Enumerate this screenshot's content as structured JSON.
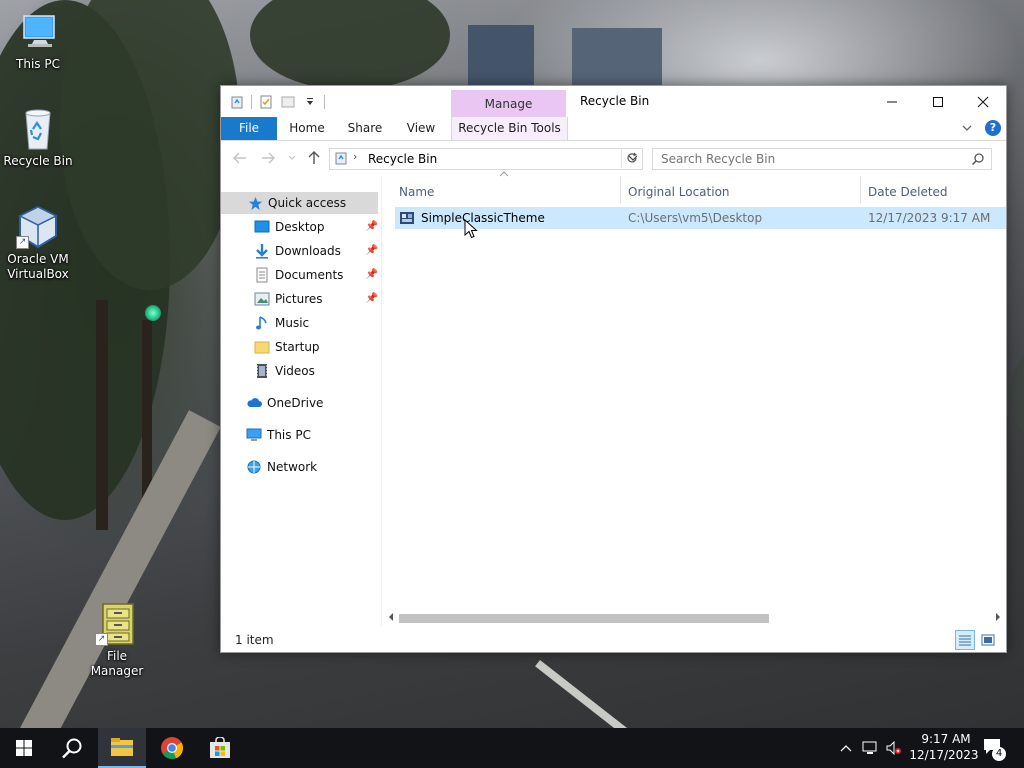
{
  "desktop": {
    "icons": [
      {
        "label": "This PC",
        "icon": "computer-icon"
      },
      {
        "label": "Recycle Bin",
        "icon": "recycle-bin-icon"
      },
      {
        "label": "Oracle VM\nVirtualBox",
        "icon": "virtualbox-icon"
      },
      {
        "label": "File Manager",
        "icon": "file-cabinet-icon"
      }
    ]
  },
  "window": {
    "title": "Recycle Bin",
    "contextual_tab_group": "Manage",
    "ribbon_tabs": [
      "File",
      "Home",
      "Share",
      "View",
      "Recycle Bin Tools"
    ],
    "address": {
      "path": [
        "Recycle Bin"
      ]
    },
    "search": {
      "placeholder": "Search Recycle Bin"
    },
    "nav": {
      "quick_access": "Quick access",
      "pinned": [
        {
          "label": "Desktop",
          "icon": "desktop-folder-icon",
          "pinned": true
        },
        {
          "label": "Downloads",
          "icon": "downloads-icon",
          "pinned": true
        },
        {
          "label": "Documents",
          "icon": "documents-icon",
          "pinned": true
        },
        {
          "label": "Pictures",
          "icon": "pictures-icon",
          "pinned": true
        },
        {
          "label": "Music",
          "icon": "music-icon",
          "pinned": false
        },
        {
          "label": "Startup",
          "icon": "folder-icon",
          "pinned": false
        },
        {
          "label": "Videos",
          "icon": "videos-icon",
          "pinned": false
        }
      ],
      "roots": [
        {
          "label": "OneDrive",
          "icon": "onedrive-icon"
        },
        {
          "label": "This PC",
          "icon": "this-pc-icon"
        },
        {
          "label": "Network",
          "icon": "network-icon"
        }
      ]
    },
    "columns": [
      "Name",
      "Original Location",
      "Date Deleted"
    ],
    "files": [
      {
        "name": "SimpleClassicTheme",
        "original_location": "C:\\Users\\vm5\\Desktop",
        "date_deleted": "12/17/2023 9:17 AM",
        "selected": true
      }
    ],
    "status": "1 item"
  },
  "taskbar": {
    "apps": [
      "start-icon",
      "search-icon",
      "file-explorer-icon",
      "chrome-icon",
      "store-icon"
    ],
    "clock": {
      "time": "9:17 AM",
      "date": "12/17/2023"
    },
    "notification_count": "4"
  },
  "colors": {
    "accent": "#1979ca",
    "selection": "#cce8ff",
    "contextual_tab": "#e9c7f2",
    "taskbar": "#111317"
  }
}
